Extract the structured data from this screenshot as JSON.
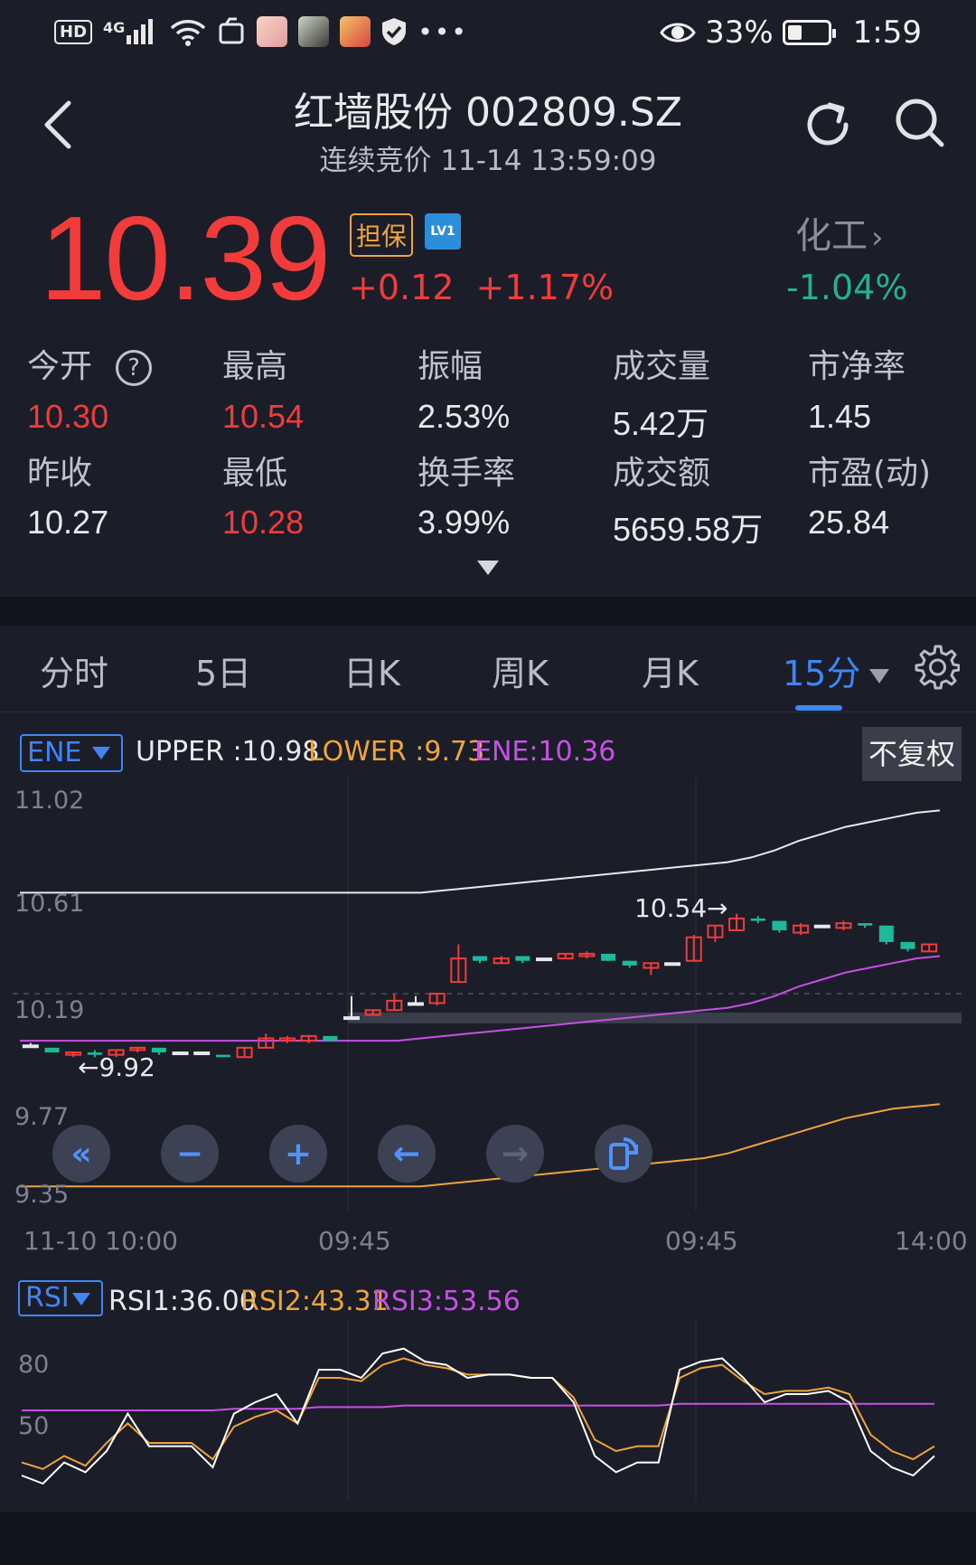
{
  "status_bar": {
    "hd_label": "HD",
    "network_label": "4G",
    "battery_pct": "33%",
    "time": "1:59"
  },
  "header": {
    "title": "红墙股份 002809.SZ",
    "subtitle": "连续竞价 11-14 13:59:09"
  },
  "quote": {
    "price": "10.39",
    "badge": "担保",
    "level_badge": "LV1",
    "change": "+0.12",
    "change_pct": "+1.17%",
    "industry_label": "化工",
    "industry_change": "-1.04%"
  },
  "stats": [
    {
      "label": "今开",
      "value": "10.30",
      "color": "red"
    },
    {
      "label": "最高",
      "value": "10.54",
      "color": "red"
    },
    {
      "label": "振幅",
      "value": "2.53%",
      "color": "white"
    },
    {
      "label": "成交量",
      "value": "5.42万",
      "color": "white"
    },
    {
      "label": "市净率",
      "value": "1.45",
      "color": "white"
    },
    {
      "label": "昨收",
      "value": "10.27",
      "color": "white"
    },
    {
      "label": "最低",
      "value": "10.28",
      "color": "red"
    },
    {
      "label": "换手率",
      "value": "3.99%",
      "color": "white"
    },
    {
      "label": "成交额",
      "value": "5659.58万",
      "color": "white"
    },
    {
      "label": "市盈(动)",
      "value": "25.84",
      "color": "white"
    }
  ],
  "tabs": [
    "分时",
    "5日",
    "日K",
    "周K",
    "月K",
    "15分"
  ],
  "active_tab": "15分",
  "main_chart": {
    "indicator": "ENE",
    "legend": {
      "upper": "UPPER :10.98",
      "lower": "LOWER :9.73",
      "ene": "ENE:10.36"
    },
    "adjust_button": "不复权",
    "y_labels": [
      "11.02",
      "10.61",
      "10.19",
      "9.77",
      "9.35"
    ],
    "x_labels": [
      "11-10 10:00",
      "09:45",
      "09:45",
      "14:00"
    ],
    "high_marker": "10.54→",
    "low_marker": "←9.92"
  },
  "chart_data": [
    {
      "type": "candlestick",
      "title": "",
      "ylim": [
        9.35,
        11.02
      ],
      "colors": {
        "up": "#f23b3b",
        "down": "#1fb89a",
        "upper": "#e8e8e8",
        "lower": "#f0a43a",
        "ene": "#c850e6"
      },
      "series": [
        {
          "name": "UPPER",
          "values": [
            10.63,
            10.63,
            10.63,
            10.63,
            10.63,
            10.63,
            10.63,
            10.63,
            10.63,
            10.63,
            10.63,
            10.63,
            10.63,
            10.63,
            10.63,
            10.63,
            10.63,
            10.63,
            10.64,
            10.65,
            10.66,
            10.67,
            10.68,
            10.69,
            10.7,
            10.71,
            10.72,
            10.73,
            10.74,
            10.75,
            10.76,
            10.78,
            10.81,
            10.85,
            10.88,
            10.91,
            10.93,
            10.95,
            10.97,
            10.98
          ]
        },
        {
          "name": "LOWER",
          "values": [
            9.38,
            9.38,
            9.38,
            9.38,
            9.38,
            9.38,
            9.38,
            9.38,
            9.38,
            9.38,
            9.38,
            9.38,
            9.38,
            9.38,
            9.38,
            9.38,
            9.38,
            9.38,
            9.39,
            9.4,
            9.41,
            9.42,
            9.43,
            9.44,
            9.45,
            9.46,
            9.47,
            9.48,
            9.49,
            9.5,
            9.52,
            9.55,
            9.58,
            9.61,
            9.64,
            9.67,
            9.69,
            9.71,
            9.72,
            9.73
          ]
        },
        {
          "name": "ENE",
          "values": [
            10.0,
            10.0,
            10.0,
            10.0,
            10.0,
            10.0,
            10.0,
            10.0,
            10.0,
            10.0,
            10.0,
            10.0,
            10.0,
            10.0,
            10.0,
            10.0,
            10.0,
            10.01,
            10.02,
            10.03,
            10.04,
            10.05,
            10.06,
            10.07,
            10.08,
            10.09,
            10.1,
            10.11,
            10.12,
            10.13,
            10.14,
            10.16,
            10.19,
            10.23,
            10.26,
            10.29,
            10.31,
            10.33,
            10.35,
            10.36
          ]
        }
      ],
      "candles": [
        {
          "o": 9.98,
          "h": 9.99,
          "l": 9.98,
          "c": 9.98
        },
        {
          "o": 9.97,
          "h": 9.97,
          "l": 9.95,
          "c": 9.95
        },
        {
          "o": 9.94,
          "h": 9.95,
          "l": 9.93,
          "c": 9.95
        },
        {
          "o": 9.95,
          "h": 9.96,
          "l": 9.93,
          "c": 9.94
        },
        {
          "o": 9.94,
          "h": 9.96,
          "l": 9.93,
          "c": 9.96
        },
        {
          "o": 9.96,
          "h": 9.97,
          "l": 9.95,
          "c": 9.97
        },
        {
          "o": 9.97,
          "h": 9.97,
          "l": 9.94,
          "c": 9.95
        },
        {
          "o": 9.95,
          "h": 9.95,
          "l": 9.95,
          "c": 9.95
        },
        {
          "o": 9.95,
          "h": 9.95,
          "l": 9.94,
          "c": 9.95
        },
        {
          "o": 9.94,
          "h": 9.94,
          "l": 9.93,
          "c": 9.93
        },
        {
          "o": 9.93,
          "h": 9.97,
          "l": 9.93,
          "c": 9.97
        },
        {
          "o": 9.97,
          "h": 10.03,
          "l": 9.97,
          "c": 10.01
        },
        {
          "o": 10.0,
          "h": 10.02,
          "l": 9.99,
          "c": 10.01
        },
        {
          "o": 10.0,
          "h": 10.02,
          "l": 9.99,
          "c": 10.02
        },
        {
          "o": 10.02,
          "h": 10.02,
          "l": 10.0,
          "c": 10.0
        },
        {
          "o": 10.1,
          "h": 10.19,
          "l": 10.1,
          "c": 10.1
        },
        {
          "o": 10.11,
          "h": 10.13,
          "l": 10.11,
          "c": 10.13
        },
        {
          "o": 10.13,
          "h": 10.2,
          "l": 10.13,
          "c": 10.17
        },
        {
          "o": 10.16,
          "h": 10.19,
          "l": 10.15,
          "c": 10.16
        },
        {
          "o": 10.16,
          "h": 10.2,
          "l": 10.15,
          "c": 10.2
        },
        {
          "o": 10.25,
          "h": 10.41,
          "l": 10.25,
          "c": 10.35
        },
        {
          "o": 10.36,
          "h": 10.36,
          "l": 10.33,
          "c": 10.34
        },
        {
          "o": 10.33,
          "h": 10.36,
          "l": 10.33,
          "c": 10.35
        },
        {
          "o": 10.36,
          "h": 10.36,
          "l": 10.33,
          "c": 10.34
        },
        {
          "o": 10.35,
          "h": 10.35,
          "l": 10.34,
          "c": 10.35
        },
        {
          "o": 10.35,
          "h": 10.37,
          "l": 10.35,
          "c": 10.37
        },
        {
          "o": 10.36,
          "h": 10.38,
          "l": 10.35,
          "c": 10.37
        },
        {
          "o": 10.37,
          "h": 10.37,
          "l": 10.34,
          "c": 10.34
        },
        {
          "o": 10.34,
          "h": 10.34,
          "l": 10.31,
          "c": 10.32
        },
        {
          "o": 10.31,
          "h": 10.33,
          "l": 10.28,
          "c": 10.33
        },
        {
          "o": 10.33,
          "h": 10.33,
          "l": 10.32,
          "c": 10.33
        },
        {
          "o": 10.34,
          "h": 10.45,
          "l": 10.34,
          "c": 10.44
        },
        {
          "o": 10.44,
          "h": 10.49,
          "l": 10.42,
          "c": 10.49
        },
        {
          "o": 10.47,
          "h": 10.54,
          "l": 10.47,
          "c": 10.52
        },
        {
          "o": 10.52,
          "h": 10.53,
          "l": 10.5,
          "c": 10.51
        },
        {
          "o": 10.51,
          "h": 10.51,
          "l": 10.46,
          "c": 10.47
        },
        {
          "o": 10.46,
          "h": 10.5,
          "l": 10.45,
          "c": 10.49
        },
        {
          "o": 10.49,
          "h": 10.49,
          "l": 10.49,
          "c": 10.49
        },
        {
          "o": 10.48,
          "h": 10.51,
          "l": 10.47,
          "c": 10.5
        },
        {
          "o": 10.5,
          "h": 10.5,
          "l": 10.48,
          "c": 10.49
        },
        {
          "o": 10.49,
          "h": 10.49,
          "l": 10.41,
          "c": 10.42
        },
        {
          "o": 10.42,
          "h": 10.42,
          "l": 10.38,
          "c": 10.39
        },
        {
          "o": 10.38,
          "h": 10.41,
          "l": 10.38,
          "c": 10.41
        }
      ]
    },
    {
      "type": "line",
      "title": "",
      "ylim": [
        0,
        100
      ],
      "y_labels": [
        "80",
        "50"
      ],
      "series": [
        {
          "name": "RSI1",
          "color": "#ffffff",
          "values": [
            10,
            5,
            18,
            12,
            25,
            48,
            28,
            28,
            28,
            15,
            48,
            55,
            60,
            42,
            75,
            75,
            70,
            85,
            88,
            80,
            78,
            70,
            72,
            72,
            70,
            70,
            55,
            22,
            12,
            18,
            18,
            75,
            80,
            82,
            70,
            55,
            60,
            60,
            62,
            55,
            25,
            15,
            10,
            22
          ]
        },
        {
          "name": "RSI2",
          "color": "#f0a43a",
          "values": [
            18,
            14,
            22,
            16,
            30,
            42,
            30,
            30,
            30,
            20,
            40,
            46,
            50,
            42,
            70,
            70,
            68,
            78,
            82,
            78,
            76,
            72,
            72,
            72,
            70,
            70,
            58,
            32,
            25,
            28,
            28,
            70,
            76,
            78,
            68,
            60,
            62,
            62,
            64,
            60,
            35,
            25,
            20,
            28
          ]
        },
        {
          "name": "RSI3",
          "color": "#c850e6",
          "values": [
            50,
            50,
            50,
            50,
            50,
            50,
            50,
            50,
            50,
            50,
            51,
            51,
            51,
            51,
            52,
            52,
            52,
            52,
            53,
            53,
            53,
            53,
            53,
            53,
            53,
            53,
            53,
            53,
            53,
            53,
            53,
            54,
            54,
            54,
            54,
            54,
            54,
            54,
            54,
            54,
            54,
            54,
            54,
            54
          ]
        }
      ]
    }
  ],
  "controls": {
    "rewind": "«",
    "zoom_out": "−",
    "zoom_in": "+",
    "prev": "←",
    "next": "→"
  },
  "rsi": {
    "indicator": "RSI",
    "rsi1": "RSI1:36.00",
    "rsi2": "RSI2:43.31",
    "rsi3": "RSI3:53.56"
  }
}
